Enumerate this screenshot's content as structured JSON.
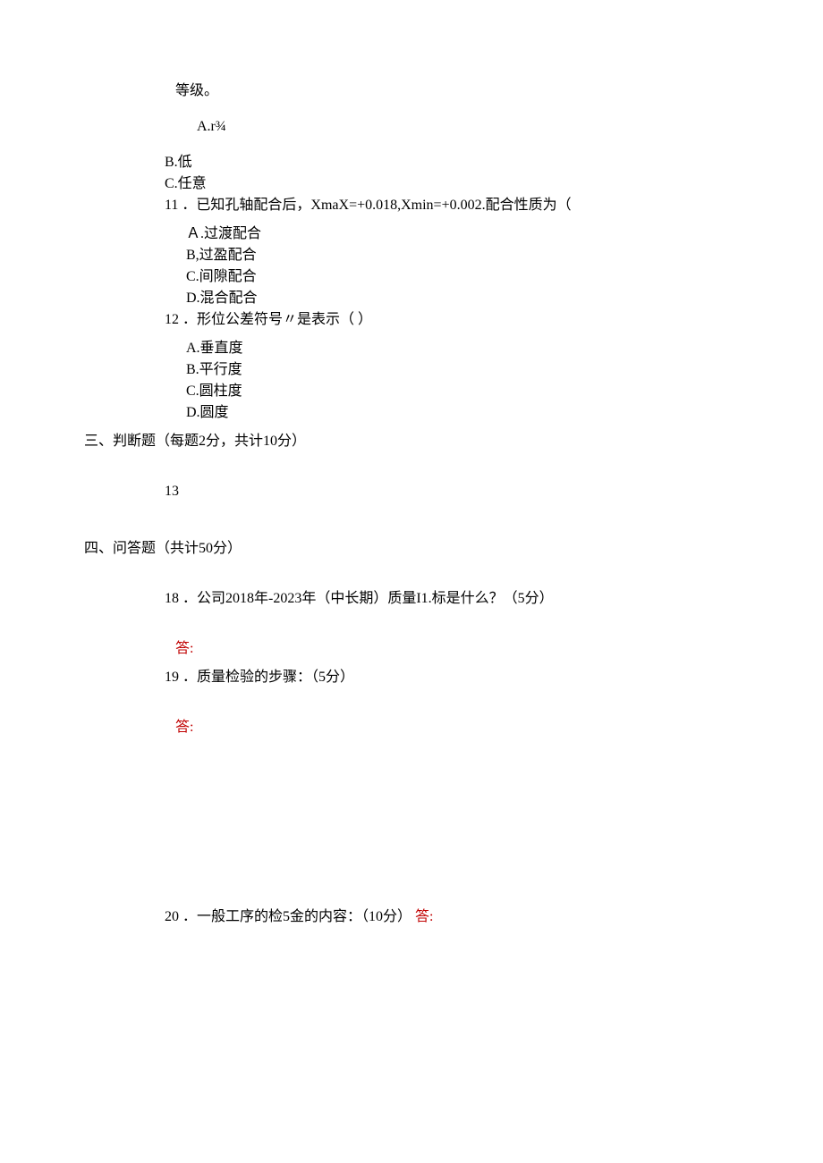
{
  "q10": {
    "tail": "等级。",
    "options": {
      "A": "A.r¾",
      "B": "B.低",
      "C": "C.任意"
    }
  },
  "q11": {
    "num": "11",
    "text": "．已知孔轴配合后，XmaX=+0.018,Xmin=+0.002.配合性质为（",
    "options": {
      "A": "Ａ.过渡配合",
      "B": "B,过盈配合",
      "C": "C.间隙配合",
      "D": "D.混合配合"
    }
  },
  "q12": {
    "num": "12",
    "text": "．形位公差符号〃是表示（            ）",
    "options": {
      "A": "A.垂直度",
      "B": "B.平行度",
      "C": "C.圆柱度",
      "D": "D.圆度"
    }
  },
  "section3": {
    "heading": "三、判断题（每题2分，共计10分）",
    "item": "13"
  },
  "section4": {
    "heading": "四、问答题（共计50分）",
    "q18": {
      "num": "18",
      "text": "．公司2018年-2023年（中长期）质量I1.标是什么？（5分）",
      "answer": "答:"
    },
    "q19": {
      "num": "19",
      "text": "．质量检验的步骤：（5分）",
      "answer": "答:"
    },
    "q20": {
      "num": "20",
      "text": "．一般工序的检5金的内容：（10分）",
      "answer": "答:"
    }
  }
}
